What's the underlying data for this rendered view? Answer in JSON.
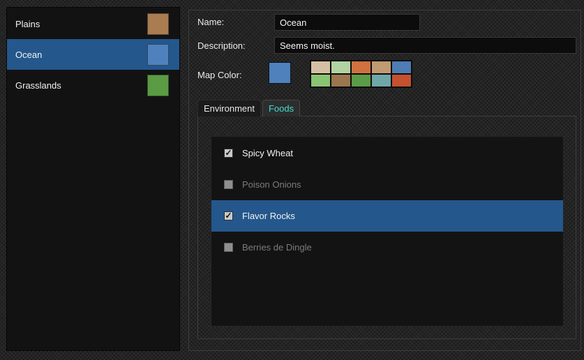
{
  "sidebar": {
    "items": [
      {
        "label": "Plains",
        "color": "#a97c52",
        "selected": false
      },
      {
        "label": "Ocean",
        "color": "#4f81bd",
        "selected": true
      },
      {
        "label": "Grasslands",
        "color": "#5a9b44",
        "selected": false
      }
    ]
  },
  "form": {
    "name_label": "Name:",
    "name_value": "Ocean",
    "description_label": "Description:",
    "description_value": "Seems moist.",
    "map_color_label": "Map Color:",
    "map_color_value": "#4f81bd",
    "palette": [
      "#d5bfa3",
      "#b1d3a2",
      "#d0713f",
      "#c09a72",
      "#4e7cb4",
      "#8ac472",
      "#9b764e",
      "#5c9b47",
      "#6fa7a8",
      "#c4512f"
    ]
  },
  "tabs": [
    {
      "label": "Environment",
      "active": false
    },
    {
      "label": "Foods",
      "active": true
    }
  ],
  "foods": {
    "items": [
      {
        "label": "Spicy Wheat",
        "checked": true,
        "selected": false
      },
      {
        "label": "Poison Onions",
        "checked": false,
        "selected": false
      },
      {
        "label": "Flavor Rocks",
        "checked": true,
        "selected": true
      },
      {
        "label": "Berries de Dingle",
        "checked": false,
        "selected": false
      }
    ]
  },
  "colors": {
    "selection_blue": "#24578c",
    "active_tab_text": "#41ddd0",
    "disabled_text": "#7c7c7c",
    "panel_background": "#131313"
  }
}
